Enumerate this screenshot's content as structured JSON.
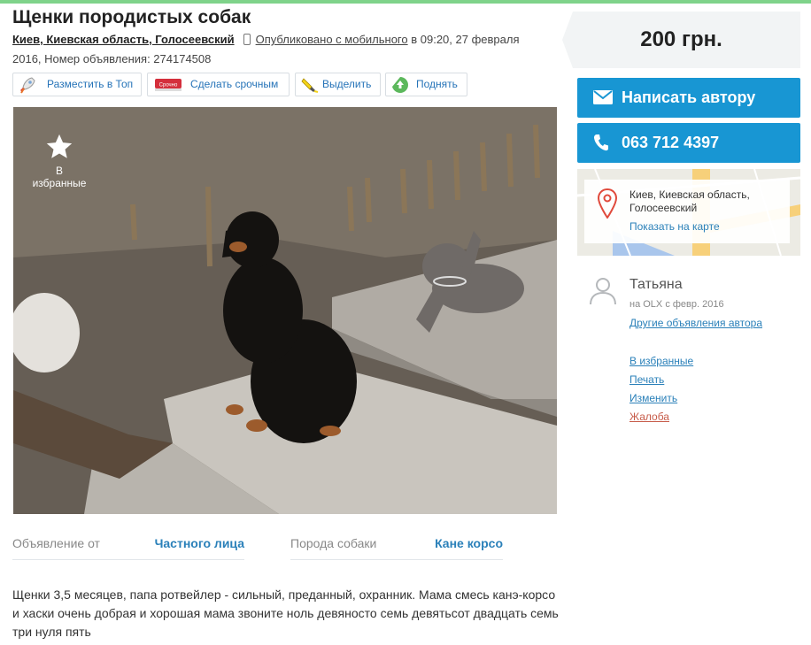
{
  "title": "Щенки породистых собак",
  "meta": {
    "location": "Киев, Киевская область, Голосеевский",
    "published_mobile": "Опубликовано с мобильного",
    "published_rest": " в 09:20, 27 февраля",
    "line2": "2016, Номер объявления: 274174508"
  },
  "actions": [
    {
      "label": "Разместить в Топ",
      "icon": "rocket-icon"
    },
    {
      "label": "Сделать срочным",
      "icon": "urgent-icon",
      "icon_text": "Срочно"
    },
    {
      "label": "Выделить",
      "icon": "highlighter-icon"
    },
    {
      "label": "Поднять",
      "icon": "raise-arrow-icon"
    }
  ],
  "favorite": {
    "label": "В избранные",
    "icon": "star-icon"
  },
  "params": [
    {
      "label": "Объявление от",
      "value": "Частного лица"
    },
    {
      "label": "Порода собаки",
      "value": "Кане корсо"
    }
  ],
  "description": "Щенки 3,5 месяцев, папа ротвейлер - сильный, преданный, охранник. Мама смесь канэ-корсо и хаски очень добрая и хорошая мама звоните ноль девяносто семь девятьсот двадцать семь три нуля пять",
  "price": "200 грн.",
  "contact": {
    "write_label": "Написать автору",
    "phone": "063 712 4397"
  },
  "map": {
    "address": "Киев, Киевская область, Голосеевский",
    "show_on_map": "Показать на карте"
  },
  "seller": {
    "name": "Татьяна",
    "since": "на OLX с февр. 2016",
    "other_ads": "Другие объявления автора"
  },
  "links": {
    "favorites": "В избранные",
    "print": "Печать",
    "edit": "Изменить",
    "report": "Жалоба"
  },
  "colors": {
    "accent": "#1896d3",
    "link": "#2a80b9",
    "report": "#c75c4a",
    "olx_green": "#7fd38a"
  }
}
